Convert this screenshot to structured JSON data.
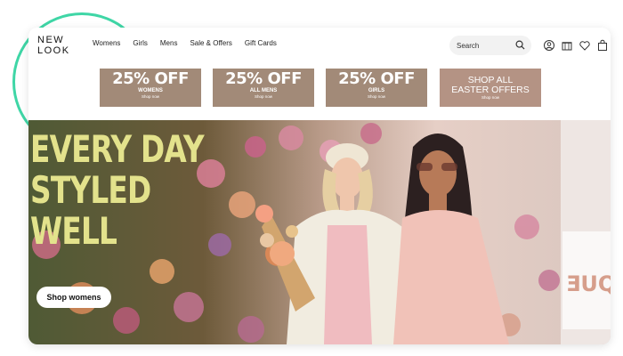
{
  "brand": {
    "line1": "NEW",
    "line2": "LOOK"
  },
  "nav": [
    "Womens",
    "Girls",
    "Mens",
    "Sale & Offers",
    "Gift Cards"
  ],
  "search": {
    "placeholder": "Search"
  },
  "header_icons": [
    "account-icon",
    "store-icon",
    "heart-icon",
    "bag-icon"
  ],
  "promos": [
    {
      "headline": "25% OFF",
      "subline": "WOMENS",
      "link": "Shop now"
    },
    {
      "headline": "25% OFF",
      "subline": "ALL MENS",
      "link": "Shop now"
    },
    {
      "headline": "25% OFF",
      "subline": "GIRLS",
      "link": "Shop now"
    },
    {
      "headline_line1": "SHOP ALL",
      "headline_line2": "EASTER OFFERS",
      "link": "Shop now"
    }
  ],
  "hero": {
    "headline": [
      "EVERY DAY",
      "STYLED",
      "WELL"
    ],
    "cta": "Shop womens",
    "headline_color": "#e3e28c"
  },
  "colors": {
    "accent_ring": "#3fd6a6",
    "promo_bg": "#a28a78"
  }
}
